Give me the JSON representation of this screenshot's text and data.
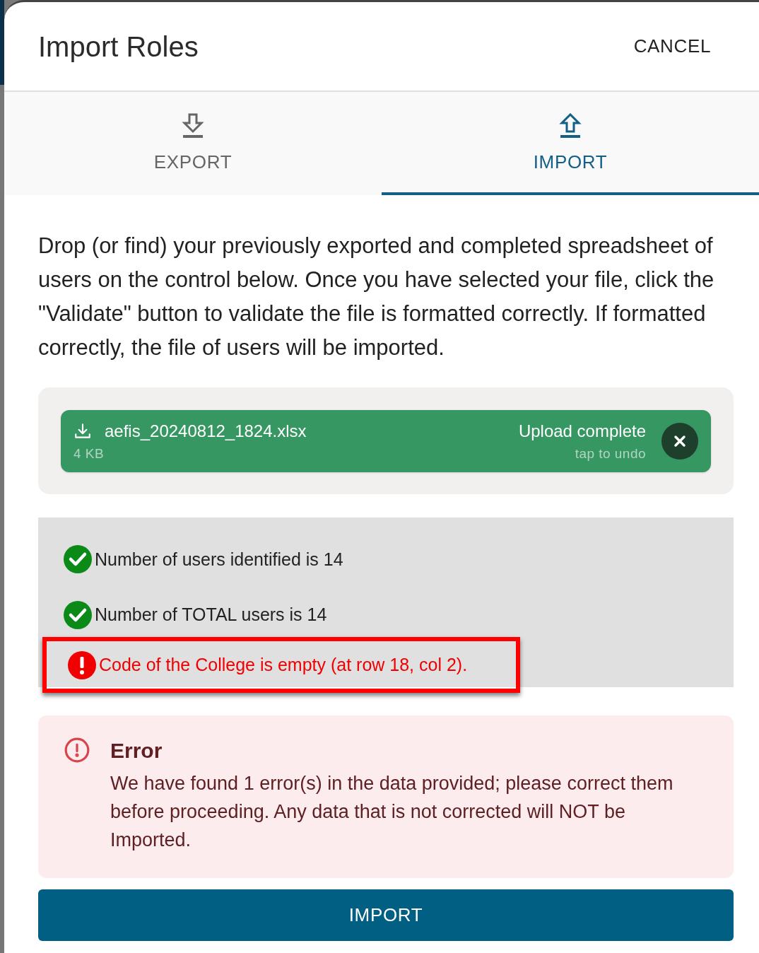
{
  "dialog": {
    "title": "Import Roles",
    "cancel_label": "CANCEL"
  },
  "tabs": [
    {
      "label": "EXPORT",
      "selected": false
    },
    {
      "label": "IMPORT",
      "selected": true
    }
  ],
  "instructions": "Drop (or find) your previously exported and completed spreadsheet of users on the control below. Once you have selected your file, click the \"Validate\" button to validate the file is formatted correctly. If formatted correctly, the file of users will be imported.",
  "upload": {
    "file_name": "aefis_20240812_1824.xlsx",
    "file_size": "4 KB",
    "status": "Upload complete",
    "hint": "tap to undo"
  },
  "validation": [
    {
      "kind": "ok",
      "text": "Number of users identified is 14",
      "highlighted": false
    },
    {
      "kind": "ok",
      "text": "Number of TOTAL users is 14",
      "highlighted": false
    },
    {
      "kind": "error",
      "text": "Code of the College is empty (at row 18, col 2).",
      "highlighted": true
    }
  ],
  "alert": {
    "title": "Error",
    "message": "We have found 1 error(s) in the data provided; please correct them before proceeding. Any data that is not corrected will NOT be Imported."
  },
  "import_button": "IMPORT"
}
